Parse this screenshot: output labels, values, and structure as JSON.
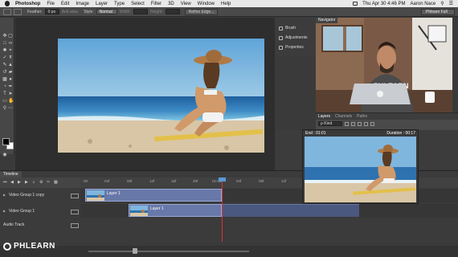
{
  "menubar": {
    "app": "Photoshop",
    "items": [
      "File",
      "Edit",
      "Image",
      "Layer",
      "Type",
      "Select",
      "Filter",
      "3D",
      "View",
      "Window",
      "Help"
    ],
    "clock": "Thu Apr 30  4:46 PM",
    "user": "Aaron Nace"
  },
  "options": {
    "feather_label": "Feather:",
    "feather_value": "0 px",
    "antialias": "Anti-alias",
    "style_label": "Style:",
    "style_value": "Normal",
    "width_label": "Width:",
    "height_label": "Height:",
    "refine_edge": "Refine Edge...",
    "workspace": "Phlearn Full"
  },
  "dock": {
    "items": [
      "Brush",
      "Adjustments",
      "Properties"
    ]
  },
  "navigator": {
    "tab": "Navigator"
  },
  "layers": {
    "tabs": [
      "Layers",
      "Channels",
      "Paths"
    ],
    "kind": "ρ Kind"
  },
  "preview": {
    "end": "End : 01:01",
    "duration": "Duration : 00:17"
  },
  "timeline": {
    "tab": "Timeline",
    "ticks": [
      "00",
      "04f",
      "08f",
      "12f",
      "16f",
      "20f",
      "01:00f",
      "04f",
      "08f",
      "12f"
    ],
    "tracks": [
      {
        "name": "Video Group 1 copy",
        "clip": "Layer 1"
      },
      {
        "name": "Video Group 1",
        "clip": "Layer 1"
      },
      {
        "name": "Audio Track"
      }
    ]
  },
  "brand": {
    "logo_text": "PHLEARN"
  },
  "colors": {
    "accent": "#5a9ad8",
    "playhead": "#e03030",
    "clip": "#6878a8"
  }
}
